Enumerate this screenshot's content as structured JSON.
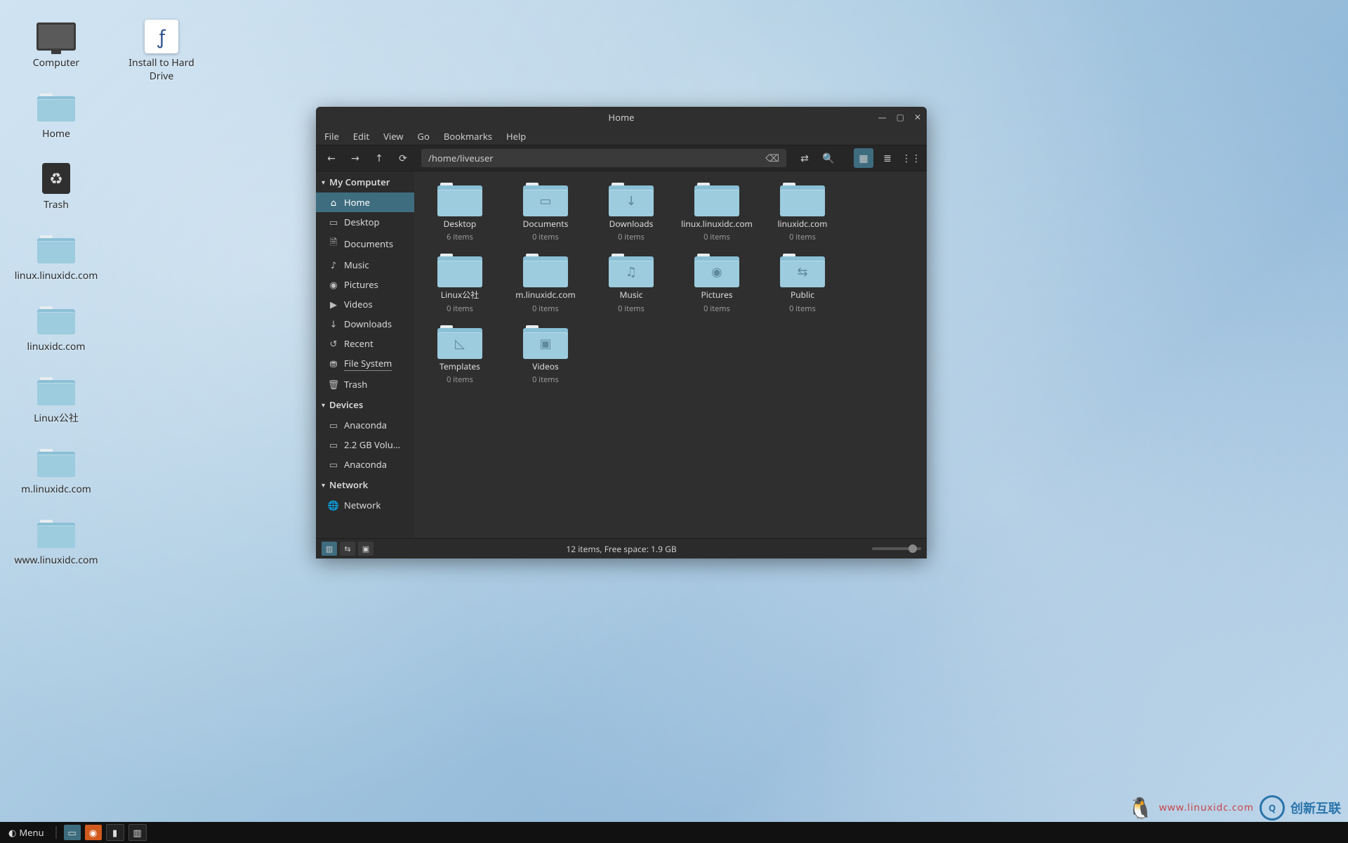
{
  "desktop": {
    "icons_col1": [
      {
        "type": "computer",
        "label": "Computer"
      },
      {
        "type": "folder",
        "label": "Home"
      },
      {
        "type": "trash",
        "label": "Trash"
      },
      {
        "type": "folder",
        "label": "linux.linuxidc.com"
      },
      {
        "type": "folder",
        "label": "linuxidc.com"
      },
      {
        "type": "folder",
        "label": "Linux公社"
      },
      {
        "type": "folder",
        "label": "m.linuxidc.com"
      },
      {
        "type": "folder",
        "label": "www.linuxidc.com"
      }
    ],
    "icons_col2": [
      {
        "type": "install",
        "label": "Install to Hard Drive"
      }
    ]
  },
  "window": {
    "title": "Home",
    "menu": [
      "File",
      "Edit",
      "View",
      "Go",
      "Bookmarks",
      "Help"
    ],
    "path": "/home/liveuser",
    "sidebar": {
      "sections": [
        {
          "title": "My Computer",
          "items": [
            {
              "icon": "home",
              "label": "Home",
              "active": true
            },
            {
              "icon": "desktop",
              "label": "Desktop"
            },
            {
              "icon": "doc",
              "label": "Documents"
            },
            {
              "icon": "music",
              "label": "Music"
            },
            {
              "icon": "pic",
              "label": "Pictures"
            },
            {
              "icon": "video",
              "label": "Videos"
            },
            {
              "icon": "down",
              "label": "Downloads"
            },
            {
              "icon": "recent",
              "label": "Recent"
            },
            {
              "icon": "fs",
              "label": "File System",
              "underline": true
            },
            {
              "icon": "trash",
              "label": "Trash"
            }
          ]
        },
        {
          "title": "Devices",
          "items": [
            {
              "icon": "disk",
              "label": "Anaconda"
            },
            {
              "icon": "disk",
              "label": "2.2 GB Volu…"
            },
            {
              "icon": "disk",
              "label": "Anaconda"
            }
          ]
        },
        {
          "title": "Network",
          "items": [
            {
              "icon": "net",
              "label": "Network"
            }
          ]
        }
      ]
    },
    "folders": [
      {
        "name": "Desktop",
        "sub": "6 items",
        "mark": ""
      },
      {
        "name": "Documents",
        "sub": "0 items",
        "mark": "▭"
      },
      {
        "name": "Downloads",
        "sub": "0 items",
        "mark": "↓"
      },
      {
        "name": "linux.linuxidc.com",
        "sub": "0 items",
        "mark": ""
      },
      {
        "name": "linuxidc.com",
        "sub": "0 items",
        "mark": ""
      },
      {
        "name": "Linux公社",
        "sub": "0 items",
        "mark": ""
      },
      {
        "name": "m.linuxidc.com",
        "sub": "0 items",
        "mark": ""
      },
      {
        "name": "Music",
        "sub": "0 items",
        "mark": "♫"
      },
      {
        "name": "Pictures",
        "sub": "0 items",
        "mark": "◉"
      },
      {
        "name": "Public",
        "sub": "0 items",
        "mark": "⇆"
      },
      {
        "name": "Templates",
        "sub": "0 items",
        "mark": "◺"
      },
      {
        "name": "Videos",
        "sub": "0 items",
        "mark": "▣"
      }
    ],
    "status": "12 items, Free space: 1.9 GB"
  },
  "taskbar": {
    "menu_label": "Menu"
  },
  "watermark": {
    "text1": "www.linuxidc.com",
    "text2": "创新互联"
  },
  "icon_glyph": {
    "home": "⌂",
    "desktop": "▭",
    "doc": "🗎",
    "music": "♪",
    "pic": "◉",
    "video": "▶",
    "down": "↓",
    "recent": "↺",
    "fs": "⛃",
    "trash": "🗑",
    "disk": "▭",
    "net": "🌐"
  }
}
